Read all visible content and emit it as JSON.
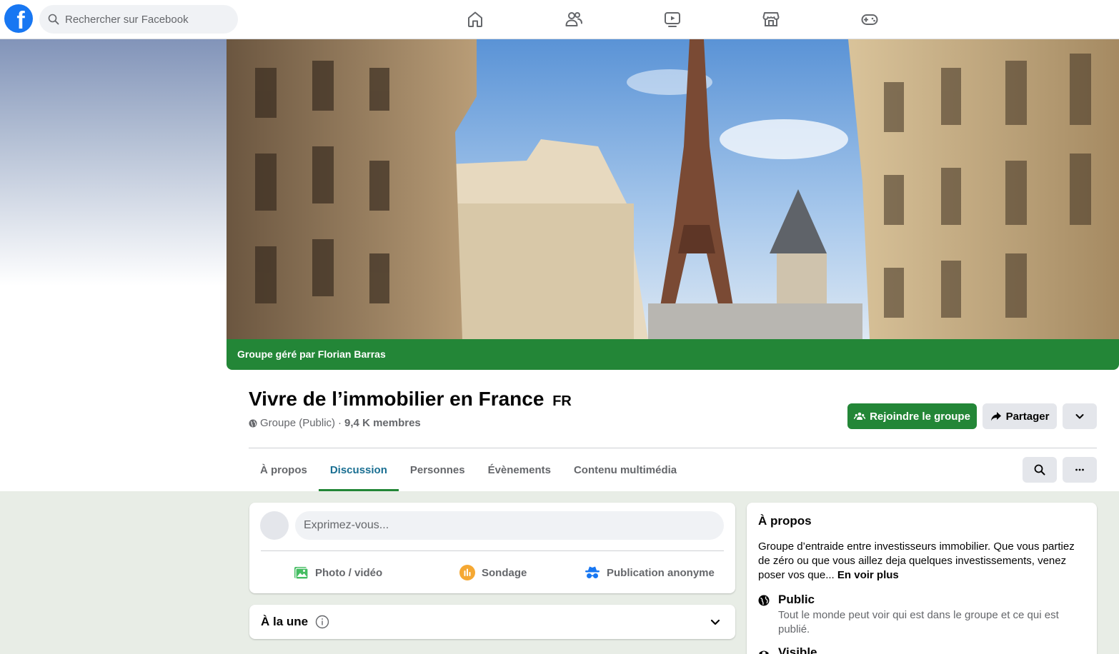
{
  "topbar": {
    "logo_letter": "f",
    "search_placeholder": "Rechercher sur Facebook",
    "nav_icons": [
      "home-icon",
      "friends-icon",
      "video-icon",
      "marketplace-icon",
      "gaming-icon"
    ]
  },
  "cover": {
    "manager_text": "Groupe géré par Florian Barras"
  },
  "group": {
    "title": "Vivre de l’immobilier en France",
    "title_flag": "FR",
    "privacy": "Groupe (Public)",
    "separator": "·",
    "members": "9,4 K membres"
  },
  "actions": {
    "join_label": "Rejoindre le groupe",
    "share_label": "Partager"
  },
  "tabs": [
    {
      "label": "À propos",
      "active": false
    },
    {
      "label": "Discussion",
      "active": true
    },
    {
      "label": "Personnes",
      "active": false
    },
    {
      "label": "Évènements",
      "active": false
    },
    {
      "label": "Contenu multimédia",
      "active": false
    }
  ],
  "composer": {
    "placeholder": "Exprimez-vous...",
    "actions": [
      {
        "label": "Photo / vidéo",
        "icon": "photo-icon"
      },
      {
        "label": "Sondage",
        "icon": "poll-icon"
      },
      {
        "label": "Publication anonyme",
        "icon": "anonymous-icon"
      }
    ]
  },
  "featured": {
    "title": "À la une"
  },
  "about": {
    "title": "À propos",
    "description": "Groupe d’entraide entre investisseurs immobilier. Que vous partiez de zéro ou que vous aillez deja quelques investissements, venez poser vos que... ",
    "see_more": "En voir plus",
    "public_label": "Public",
    "public_desc": "Tout le monde peut voir qui est dans le groupe et ce qui est publié.",
    "visible_label": "Visible"
  },
  "colors": {
    "accent_green": "#238637",
    "active_tab": "#1a6f92",
    "fb_blue": "#1877f2"
  }
}
